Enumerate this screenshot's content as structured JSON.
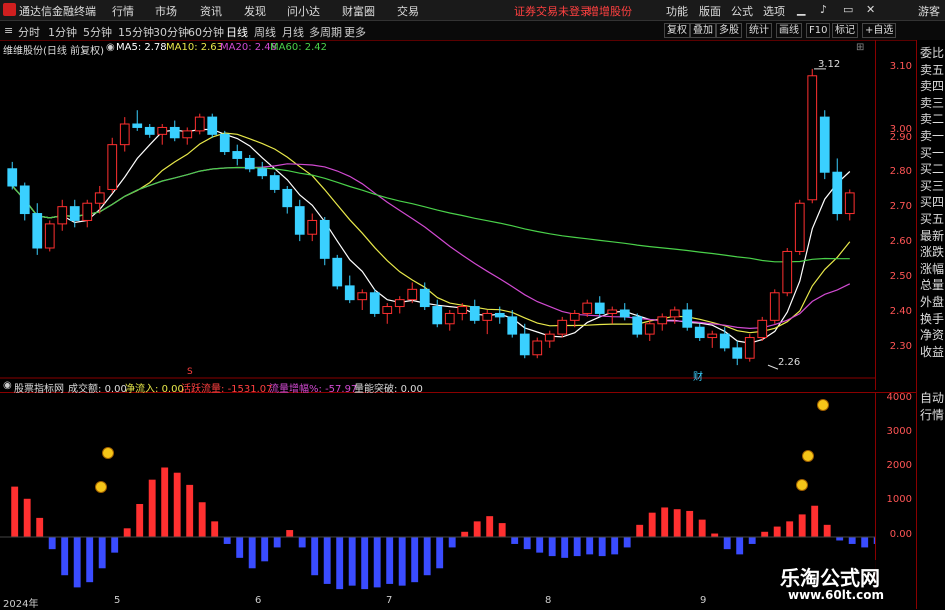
{
  "app": {
    "title": "通达信金融终端"
  },
  "menu": [
    "行情",
    "市场",
    "资讯",
    "发现",
    "问小达",
    "财富圈",
    "交易"
  ],
  "notice": "证券交易未登录",
  "notice2": "增增股份",
  "right_menu": [
    "功能",
    "版面",
    "公式",
    "选项"
  ],
  "guest": "游客",
  "periods": [
    "分时",
    "1分钟",
    "5分钟",
    "15分钟",
    "30分钟",
    "60分钟",
    "日线",
    "周线",
    "月线",
    "多周期",
    "更多"
  ],
  "active_period": "日线",
  "tools": [
    "复权",
    "叠加",
    "多股",
    "统计",
    "画线",
    "F10",
    "标记",
    "+自选"
  ],
  "stock_title": "维维股份(日线 前复权)",
  "ma": [
    {
      "label": "MA5: 2.78",
      "color": "#ffffff"
    },
    {
      "label": "MA10: 2.63",
      "color": "#e8e84a"
    },
    {
      "label": "MA20: 2.48",
      "color": "#d14ad1"
    },
    {
      "label": "MA60: 2.42",
      "color": "#4ad14a"
    }
  ],
  "price_ticks": [
    "3.10",
    "3.00",
    "2.90",
    "2.80",
    "2.70",
    "2.60",
    "2.50",
    "2.40",
    "2.30"
  ],
  "annotations": {
    "high": "3.12",
    "low": "2.26",
    "cai": "财",
    "s": "S"
  },
  "indicator": {
    "name": "股票指标网",
    "items": [
      {
        "label": "成交额:",
        "value": "0.00",
        "color": "#dddddd"
      },
      {
        "label": "净流入:",
        "value": "0.00",
        "color": "#e8e84a"
      },
      {
        "label": "活跃流量:",
        "value": "-1531.07",
        "color": "#ff4040"
      },
      {
        "label": "流量增幅%:",
        "value": "-57.97",
        "color": "#d14ad1"
      },
      {
        "label": "量能突破:",
        "value": "0.00",
        "color": "#dddddd"
      }
    ]
  },
  "indicator_ticks": [
    "4000",
    "3000",
    "2000",
    "1000",
    "0.00"
  ],
  "side_items": [
    "委比",
    "卖五",
    "卖四",
    "卖三",
    "卖二",
    "卖一",
    "买一",
    "买二",
    "买三",
    "买四",
    "买五",
    "最新",
    "涨跌",
    "涨幅",
    "总量",
    "外盘",
    "换手",
    "净资",
    "收益",
    "自动",
    "行情"
  ],
  "dates": [
    "2024年",
    "5",
    "6",
    "7",
    "8",
    "9"
  ],
  "watermark": {
    "title": "乐淘公式网",
    "url": "www.60lt.com"
  },
  "colors": {
    "up": "#ff3030",
    "down": "#3ad0ff",
    "axis": "#8a0000"
  },
  "chart_data": {
    "type": "candlestick",
    "ylim": [
      2.24,
      3.14
    ],
    "candles": [
      [
        2.83,
        2.85,
        2.77,
        2.78
      ],
      [
        2.78,
        2.79,
        2.68,
        2.7
      ],
      [
        2.7,
        2.73,
        2.58,
        2.6
      ],
      [
        2.6,
        2.68,
        2.59,
        2.67
      ],
      [
        2.67,
        2.74,
        2.65,
        2.72
      ],
      [
        2.72,
        2.74,
        2.66,
        2.68
      ],
      [
        2.68,
        2.74,
        2.66,
        2.73
      ],
      [
        2.73,
        2.78,
        2.7,
        2.76
      ],
      [
        2.77,
        2.92,
        2.76,
        2.9
      ],
      [
        2.9,
        2.98,
        2.88,
        2.96
      ],
      [
        2.96,
        3.0,
        2.94,
        2.95
      ],
      [
        2.95,
        2.96,
        2.92,
        2.93
      ],
      [
        2.93,
        2.96,
        2.9,
        2.95
      ],
      [
        2.95,
        2.97,
        2.91,
        2.92
      ],
      [
        2.92,
        2.95,
        2.9,
        2.94
      ],
      [
        2.94,
        2.99,
        2.93,
        2.98
      ],
      [
        2.98,
        2.99,
        2.92,
        2.93
      ],
      [
        2.93,
        2.94,
        2.87,
        2.88
      ],
      [
        2.88,
        2.9,
        2.84,
        2.86
      ],
      [
        2.86,
        2.87,
        2.82,
        2.83
      ],
      [
        2.83,
        2.85,
        2.8,
        2.81
      ],
      [
        2.81,
        2.82,
        2.76,
        2.77
      ],
      [
        2.77,
        2.78,
        2.7,
        2.72
      ],
      [
        2.72,
        2.74,
        2.62,
        2.64
      ],
      [
        2.64,
        2.7,
        2.62,
        2.68
      ],
      [
        2.68,
        2.69,
        2.55,
        2.57
      ],
      [
        2.57,
        2.58,
        2.48,
        2.49
      ],
      [
        2.49,
        2.52,
        2.44,
        2.45
      ],
      [
        2.45,
        2.48,
        2.42,
        2.47
      ],
      [
        2.47,
        2.48,
        2.4,
        2.41
      ],
      [
        2.41,
        2.44,
        2.38,
        2.43
      ],
      [
        2.43,
        2.46,
        2.41,
        2.45
      ],
      [
        2.45,
        2.5,
        2.44,
        2.48
      ],
      [
        2.48,
        2.5,
        2.42,
        2.43
      ],
      [
        2.43,
        2.45,
        2.37,
        2.38
      ],
      [
        2.38,
        2.42,
        2.36,
        2.41
      ],
      [
        2.41,
        2.44,
        2.39,
        2.43
      ],
      [
        2.43,
        2.45,
        2.38,
        2.39
      ],
      [
        2.39,
        2.42,
        2.35,
        2.41
      ],
      [
        2.41,
        2.43,
        2.38,
        2.4
      ],
      [
        2.4,
        2.42,
        2.34,
        2.35
      ],
      [
        2.35,
        2.38,
        2.28,
        2.29
      ],
      [
        2.29,
        2.34,
        2.28,
        2.33
      ],
      [
        2.33,
        2.36,
        2.31,
        2.35
      ],
      [
        2.35,
        2.4,
        2.34,
        2.39
      ],
      [
        2.39,
        2.42,
        2.37,
        2.41
      ],
      [
        2.41,
        2.45,
        2.4,
        2.44
      ],
      [
        2.44,
        2.46,
        2.4,
        2.41
      ],
      [
        2.41,
        2.43,
        2.38,
        2.42
      ],
      [
        2.42,
        2.44,
        2.39,
        2.4
      ],
      [
        2.4,
        2.41,
        2.34,
        2.35
      ],
      [
        2.35,
        2.39,
        2.33,
        2.38
      ],
      [
        2.38,
        2.41,
        2.36,
        2.4
      ],
      [
        2.4,
        2.43,
        2.38,
        2.42
      ],
      [
        2.42,
        2.44,
        2.36,
        2.37
      ],
      [
        2.37,
        2.38,
        2.33,
        2.34
      ],
      [
        2.34,
        2.36,
        2.31,
        2.35
      ],
      [
        2.35,
        2.37,
        2.3,
        2.31
      ],
      [
        2.31,
        2.33,
        2.26,
        2.28
      ],
      [
        2.28,
        2.35,
        2.27,
        2.34
      ],
      [
        2.34,
        2.4,
        2.33,
        2.39
      ],
      [
        2.39,
        2.48,
        2.38,
        2.47
      ],
      [
        2.47,
        2.6,
        2.46,
        2.59
      ],
      [
        2.59,
        2.74,
        2.58,
        2.73
      ],
      [
        2.74,
        3.12,
        2.73,
        3.1
      ],
      [
        2.98,
        3.0,
        2.8,
        2.82
      ],
      [
        2.82,
        2.86,
        2.68,
        2.7
      ],
      [
        2.7,
        2.77,
        2.68,
        2.76
      ]
    ],
    "ma_series": [
      {
        "name": "MA5",
        "color": "#ffffff"
      },
      {
        "name": "MA10",
        "color": "#e8e84a"
      },
      {
        "name": "MA20",
        "color": "#d14ad1"
      },
      {
        "name": "MA60",
        "color": "#4ad14a"
      }
    ],
    "indicator_bars": [
      1450,
      1100,
      550,
      -350,
      -1100,
      -1450,
      -1300,
      -900,
      -450,
      250,
      950,
      1650,
      2000,
      1850,
      1500,
      1000,
      450,
      -200,
      -600,
      -900,
      -700,
      -300,
      200,
      -300,
      -1100,
      -1350,
      -1500,
      -1400,
      -1500,
      -1450,
      -1350,
      -1400,
      -1300,
      -1100,
      -900,
      -300,
      150,
      450,
      600,
      400,
      -200,
      -350,
      -450,
      -550,
      -600,
      -550,
      -500,
      -550,
      -500,
      -300,
      350,
      700,
      850,
      800,
      750,
      500,
      100,
      -350,
      -500,
      -200,
      150,
      300,
      450,
      650,
      900,
      350,
      -100,
      -200,
      -300,
      -200,
      -300,
      -350,
      -500,
      -350,
      500,
      1400,
      2300,
      3300,
      1900,
      -300
    ]
  }
}
